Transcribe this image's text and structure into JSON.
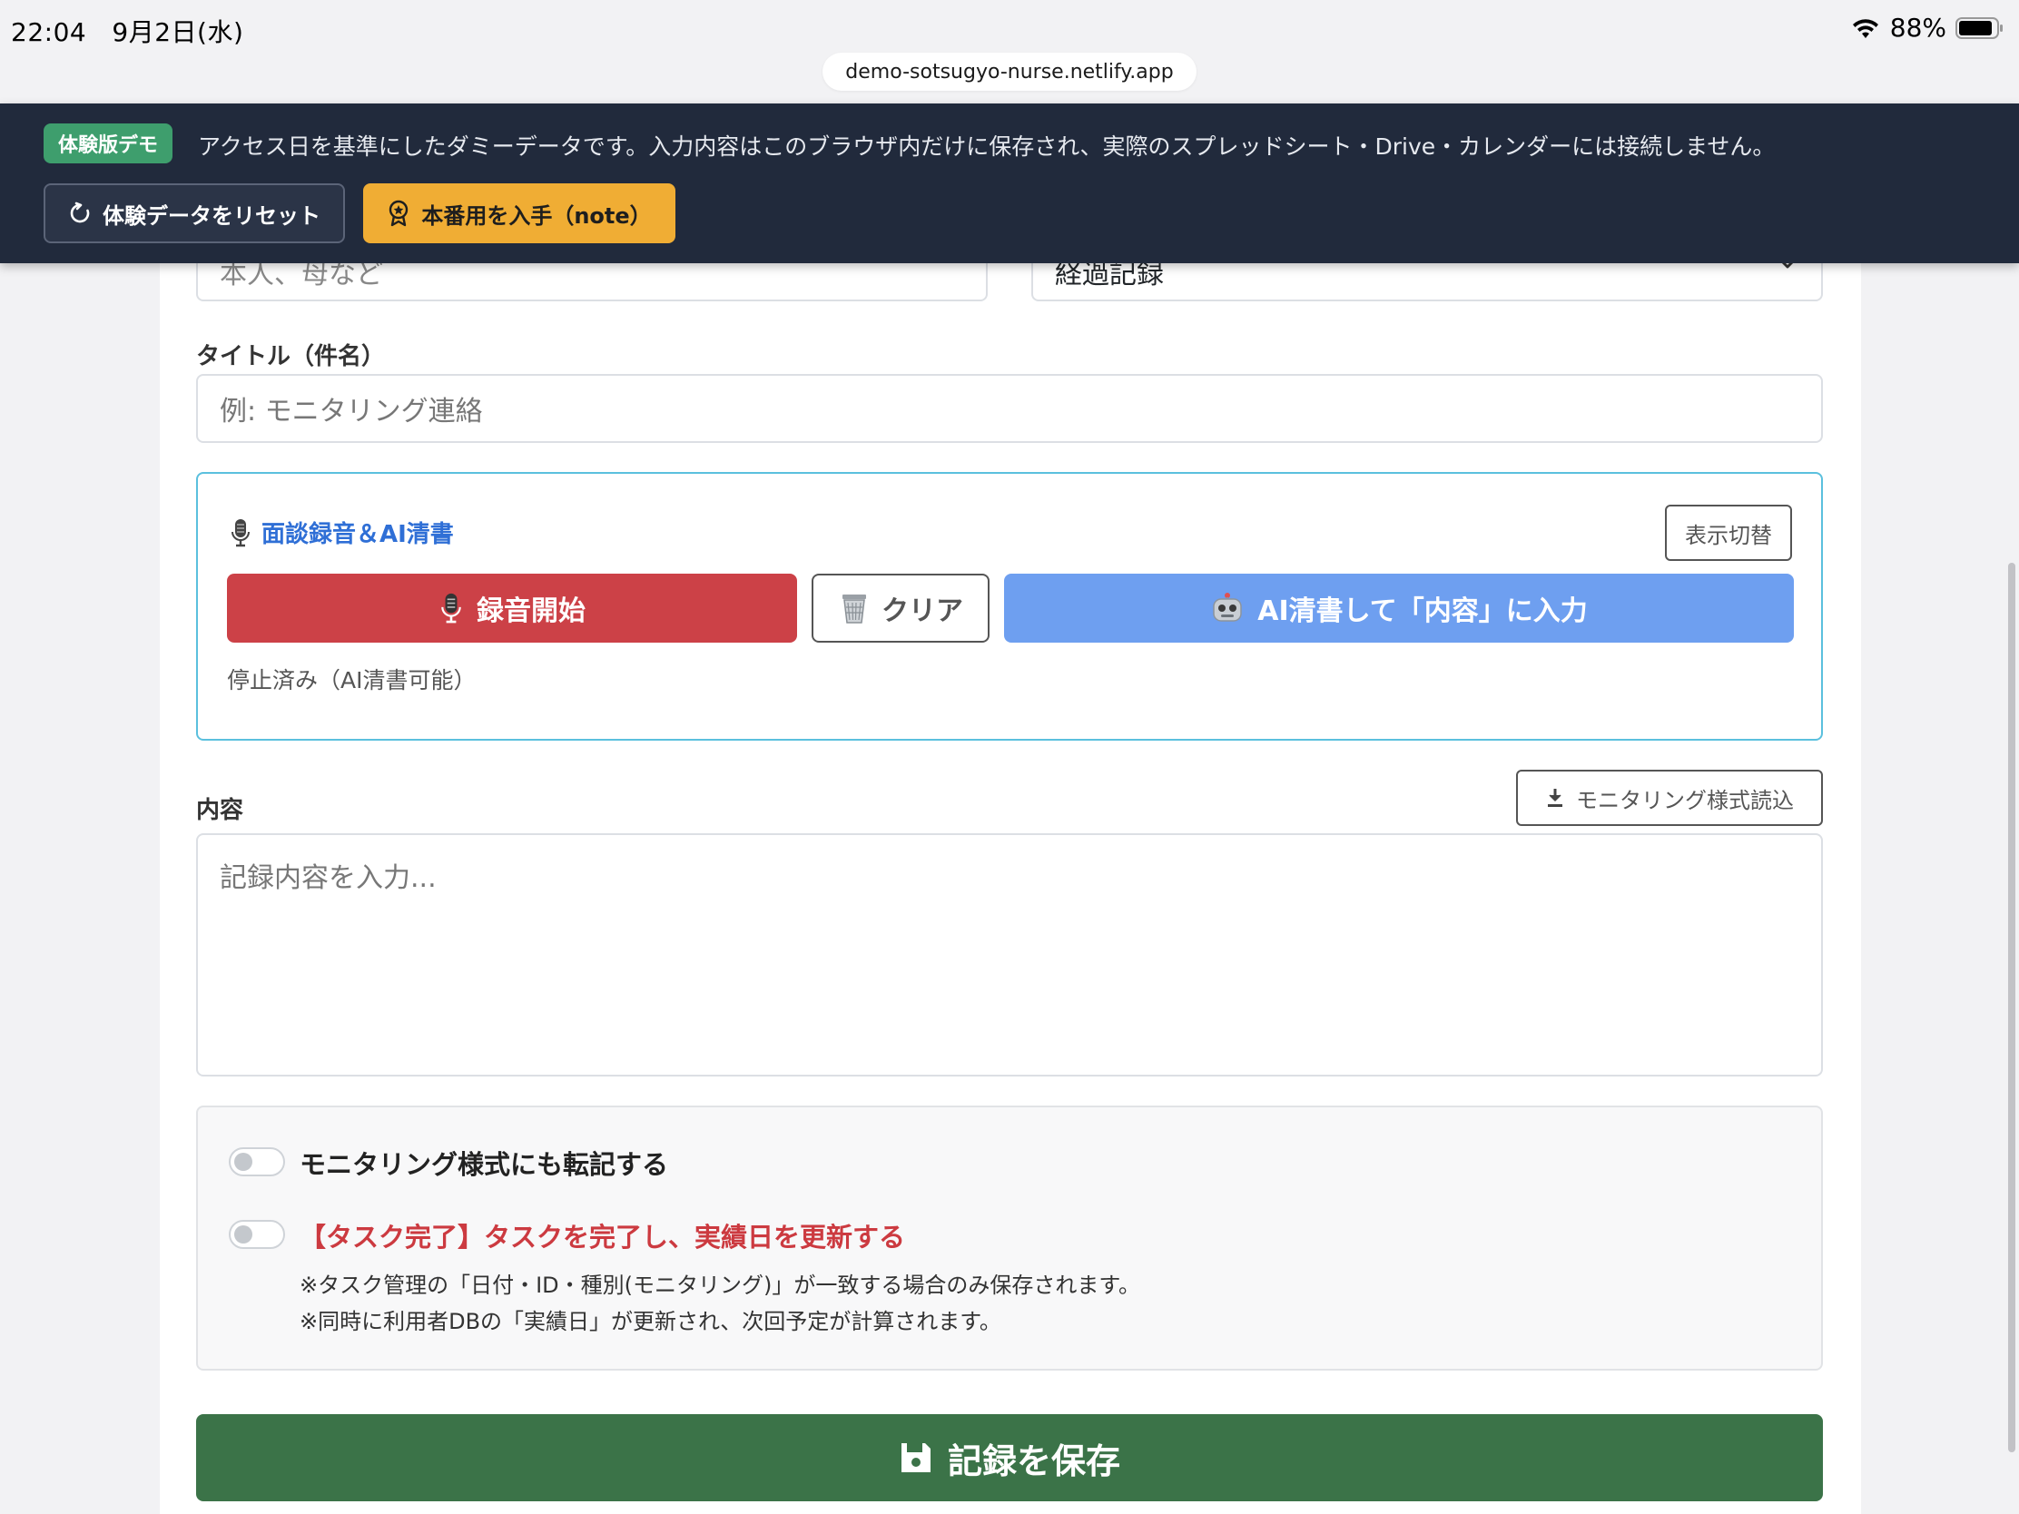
{
  "status_bar": {
    "time": "22:04",
    "date": "9月2日(水)",
    "battery": "88%",
    "url": "demo-sotsugyo-nurse.netlify.app"
  },
  "demo_banner": {
    "badge": "体験版デモ",
    "message": "アクセス日を基準にしたダミーデータです。入力内容はこのブラウザ内だけに保存され、実際のスプレッドシート・Drive・カレンダーには接続しません。",
    "reset_label": "体験データをリセット",
    "get_label": "本番用を入手（note）"
  },
  "form": {
    "contact_placeholder": "本人、母など",
    "record_type_value": "経過記録",
    "title_label": "タイトル（件名）",
    "title_placeholder": "例: モニタリング連絡",
    "content_label": "内容",
    "content_placeholder": "記録内容を入力...",
    "load_monitoring_label": "モニタリング様式読込"
  },
  "recorder": {
    "title": "面談録音＆AI清書",
    "toggle_view_label": "表示切替",
    "start_label": "録音開始",
    "clear_label": "クリア",
    "ai_label": "AI清書して「内容」に入力",
    "status": "停止済み（AI清書可能）"
  },
  "options": {
    "transcribe_label": "モニタリング様式にも転記する",
    "task_complete_label": "【タスク完了】タスクを完了し、実績日を更新する",
    "note1": "※タスク管理の「日付・ID・種別(モニタリング)」が一致する場合のみ保存されます。",
    "note2": "※同時に利用者DBの「実績日」が更新され、次回予定が計算されます。"
  },
  "save_label": "記録を保存",
  "colors": {
    "banner_bg": "#212a3c",
    "badge_green": "#3e9e6d",
    "note_orange": "#f0ad34",
    "record_red": "#cc4147",
    "ai_blue": "#6e9ff0",
    "save_green": "#3b7348",
    "panel_border": "#5bc0de"
  }
}
